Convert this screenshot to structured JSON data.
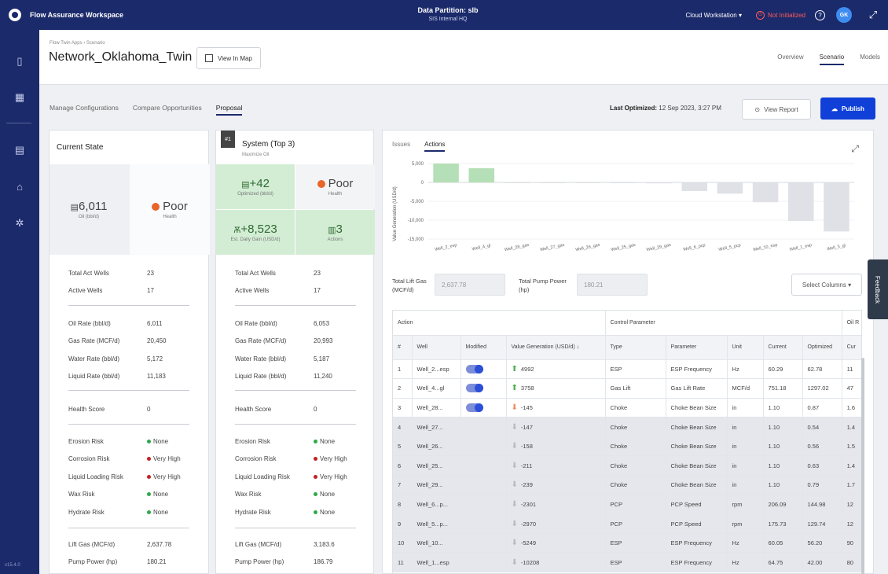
{
  "app": {
    "title": "Flow Assurance Workspace",
    "partition_label": "Data Partition: slb",
    "partition_sub": "SIS Internal HQ",
    "workstation": "Cloud Workstation",
    "status": "Not Initialized",
    "avatar_initials": "GK",
    "version": "v15.4.0"
  },
  "page": {
    "breadcrumb": "Flow Twin Apps › Scenario",
    "title": "Network_Oklahoma_Twin",
    "view_map": "View In Map",
    "tabs": [
      "Overview",
      "Scenario",
      "Models"
    ],
    "active_tab": "Scenario"
  },
  "subtabs": {
    "items": [
      "Manage Configurations",
      "Compare Opportunities",
      "Proposal"
    ],
    "active": "Proposal"
  },
  "toolbar": {
    "last_optimized_label": "Last Optimized:",
    "last_optimized_value": "12 Sep 2023, 3:27 PM",
    "view_report": "View Report",
    "publish": "Publish"
  },
  "current_state": {
    "title": "Current State",
    "kpi_oil": "6,011",
    "kpi_oil_sub": "Oil (bbl/d)",
    "kpi_health": "Poor",
    "kpi_health_sub": "Health",
    "rows": [
      {
        "k": "Total Act Wells",
        "v": "23"
      },
      {
        "k": "Active Wells",
        "v": "17"
      },
      {
        "k": "Oil Rate (bbl/d)",
        "v": "6,011"
      },
      {
        "k": "Gas Rate (MCF/d)",
        "v": "20,450"
      },
      {
        "k": "Water Rate (bbl/d)",
        "v": "5,172"
      },
      {
        "k": "Liquid Rate (bbl/d)",
        "v": "11,183"
      },
      {
        "k": "Health Score",
        "v": "0"
      },
      {
        "k": "Erosion Risk",
        "v": "None"
      },
      {
        "k": "Corrosion Risk",
        "v": "Very High"
      },
      {
        "k": "Liquid Loading Risk",
        "v": "Very High"
      },
      {
        "k": "Wax Risk",
        "v": "None"
      },
      {
        "k": "Hydrate Risk",
        "v": "None"
      },
      {
        "k": "Lift Gas (MCF/d)",
        "v": "2,637.78"
      },
      {
        "k": "Pump Power (hp)",
        "v": "180.21"
      }
    ]
  },
  "system": {
    "badge": "#1",
    "title": "System (Top 3)",
    "subtitle": "Maximize Oil",
    "kpi_opt": "+42",
    "kpi_opt_sub": "Optimized (bbl/d)",
    "kpi_health": "Poor",
    "kpi_health_sub": "Health",
    "kpi_gain": "+8,523",
    "kpi_gain_sub": "Est. Daily Gain (USD/d)",
    "kpi_actions": "3",
    "kpi_actions_sub": "Actions",
    "rows": [
      {
        "k": "Total Act Wells",
        "v": "23"
      },
      {
        "k": "Active Wells",
        "v": "17"
      },
      {
        "k": "Oil Rate (bbl/d)",
        "v": "6,053"
      },
      {
        "k": "Gas Rate (MCF/d)",
        "v": "20,993"
      },
      {
        "k": "Water Rate (bbl/d)",
        "v": "5,187"
      },
      {
        "k": "Liquid Rate (bbl/d)",
        "v": "11,240"
      },
      {
        "k": "Health Score",
        "v": "0"
      },
      {
        "k": "Erosion Risk",
        "v": "None"
      },
      {
        "k": "Corrosion Risk",
        "v": "Very High"
      },
      {
        "k": "Liquid Loading Risk",
        "v": "Very High"
      },
      {
        "k": "Wax Risk",
        "v": "None"
      },
      {
        "k": "Hydrate Risk",
        "v": "None"
      },
      {
        "k": "Lift Gas (MCF/d)",
        "v": "3,183.6"
      },
      {
        "k": "Pump Power (hp)",
        "v": "186.79"
      }
    ]
  },
  "actions": {
    "tabs": [
      "Issues",
      "Actions"
    ],
    "active_tab": "Actions",
    "total_lift_gas_label": "Total Lift Gas (MCF/d)",
    "total_lift_gas_value": "2,637.78",
    "total_pump_power_label": "Total Pump Power (hp)",
    "total_pump_power_value": "180.21",
    "select_columns": "Select Columns",
    "group_headers": {
      "action": "Action",
      "control": "Control Parameter",
      "oil": "Oil R"
    },
    "columns": [
      "#",
      "Well",
      "Modified",
      "Value Generation (USD/d)",
      "Type",
      "Parameter",
      "Unit",
      "Current",
      "Optimized",
      "Cur"
    ],
    "rows": [
      {
        "n": "1",
        "well": "Well_2...esp",
        "mod": true,
        "dir": "up",
        "val": "4992",
        "type": "ESP",
        "param": "ESP Frequency",
        "unit": "Hz",
        "cur": "60.29",
        "opt": "62.78",
        "c2": "11"
      },
      {
        "n": "2",
        "well": "Well_4...gl",
        "mod": true,
        "dir": "up",
        "val": "3758",
        "type": "Gas Lift",
        "param": "Gas Lift Rate",
        "unit": "MCF/d",
        "cur": "751.18",
        "opt": "1297.02",
        "c2": "47"
      },
      {
        "n": "3",
        "well": "Well_28...",
        "mod": true,
        "dir": "down",
        "val": "-145",
        "type": "Choke",
        "param": "Choke Bean Size",
        "unit": "in",
        "cur": "1.10",
        "opt": "0.87",
        "c2": "1.6"
      },
      {
        "n": "4",
        "well": "Well_27...",
        "mod": false,
        "dir": "grey",
        "val": "-147",
        "type": "Choke",
        "param": "Choke Bean Size",
        "unit": "in",
        "cur": "1.10",
        "opt": "0.54",
        "c2": "1.4"
      },
      {
        "n": "5",
        "well": "Well_26...",
        "mod": false,
        "dir": "grey",
        "val": "-158",
        "type": "Choke",
        "param": "Choke Bean Size",
        "unit": "in",
        "cur": "1.10",
        "opt": "0.56",
        "c2": "1.5"
      },
      {
        "n": "6",
        "well": "Well_25...",
        "mod": false,
        "dir": "grey",
        "val": "-211",
        "type": "Choke",
        "param": "Choke Bean Size",
        "unit": "in",
        "cur": "1.10",
        "opt": "0.63",
        "c2": "1.4"
      },
      {
        "n": "7",
        "well": "Well_29...",
        "mod": false,
        "dir": "grey",
        "val": "-239",
        "type": "Choke",
        "param": "Choke Bean Size",
        "unit": "in",
        "cur": "1.10",
        "opt": "0.79",
        "c2": "1.7"
      },
      {
        "n": "8",
        "well": "Well_6...p...",
        "mod": false,
        "dir": "grey",
        "val": "-2301",
        "type": "PCP",
        "param": "PCP Speed",
        "unit": "rpm",
        "cur": "206.09",
        "opt": "144.98",
        "c2": "12"
      },
      {
        "n": "9",
        "well": "Well_5...p...",
        "mod": false,
        "dir": "grey",
        "val": "-2970",
        "type": "PCP",
        "param": "PCP Speed",
        "unit": "rpm",
        "cur": "175.73",
        "opt": "129.74",
        "c2": "12"
      },
      {
        "n": "10",
        "well": "Well_10...",
        "mod": false,
        "dir": "grey",
        "val": "-5249",
        "type": "ESP",
        "param": "ESP Frequency",
        "unit": "Hz",
        "cur": "60.05",
        "opt": "56.20",
        "c2": "90"
      },
      {
        "n": "11",
        "well": "Well_1...esp",
        "mod": false,
        "dir": "grey",
        "val": "-10208",
        "type": "ESP",
        "param": "ESP Frequency",
        "unit": "Hz",
        "cur": "64.75",
        "opt": "42.00",
        "c2": "80"
      }
    ]
  },
  "feedback": "Feedback",
  "chart_data": {
    "type": "bar",
    "ylabel": "Value Generation (USD/d)",
    "ylim": [
      -15000,
      5000
    ],
    "yticks": [
      "5,000",
      "0",
      "-5,000",
      "-10,000",
      "-15,000"
    ],
    "ytick_values": [
      5000,
      0,
      -5000,
      -10000,
      -15000
    ],
    "categories": [
      "Well_2_esp",
      "Well_4_gl",
      "Well_28_gas",
      "Well_27_gas",
      "Well_26_gas",
      "Well_25_gas",
      "Well_29_gas",
      "Well_6_pcp",
      "Well_5_pcp",
      "Well_10_esp",
      "Well_1_esp",
      "Well_3_gl"
    ],
    "values": [
      4992,
      3758,
      -145,
      -147,
      -158,
      -211,
      -239,
      -2301,
      -2970,
      -5249,
      -10208,
      -13000
    ],
    "colors": {
      "positive": "#b5dfb6",
      "negative": "#dfe1e6"
    },
    "grid": true
  }
}
